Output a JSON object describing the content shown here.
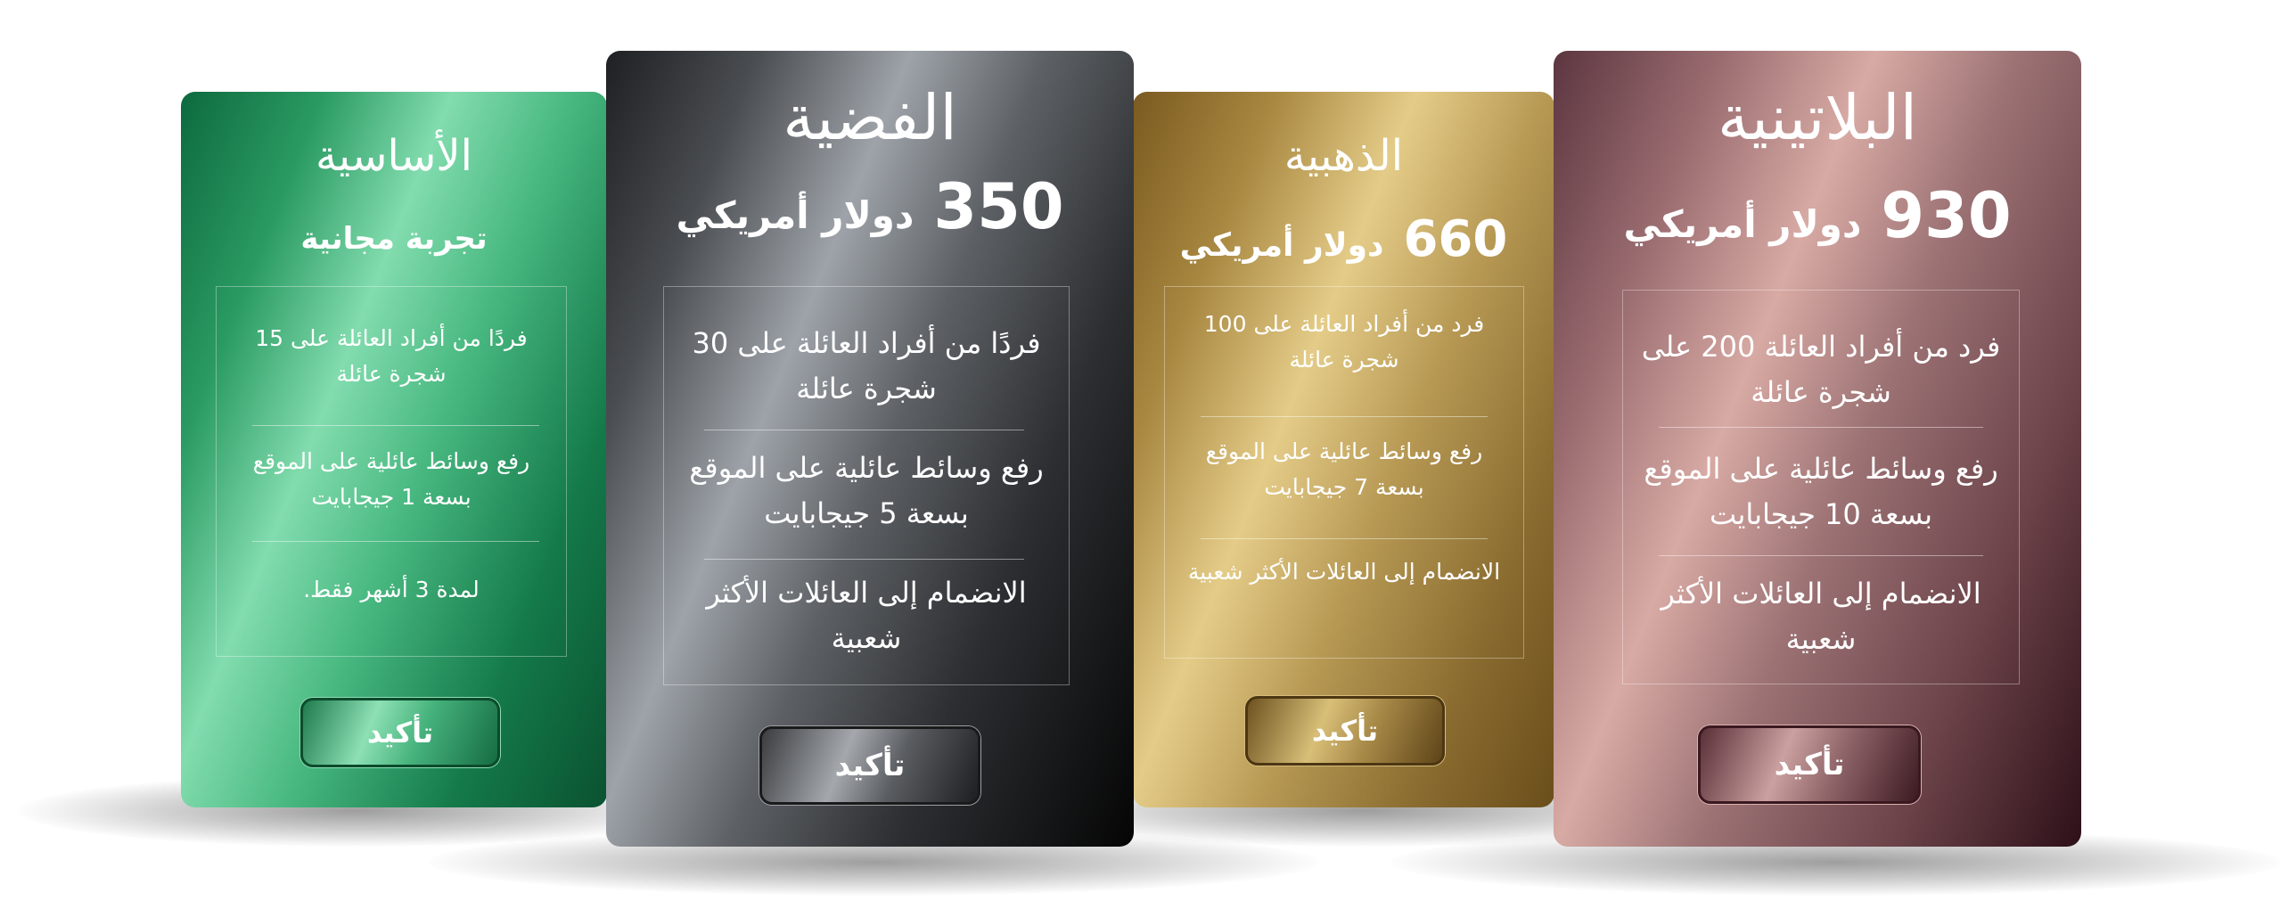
{
  "plans": {
    "basic": {
      "title": "الأساسية",
      "subtitle": "تجربة مجانية",
      "features": [
        "فردًا من أفراد العائلة على 15 شجرة عائلة",
        "رفع وسائط عائلية على الموقع بسعة 1 جيجابايت",
        "لمدة 3 أشهر فقط."
      ],
      "button_label": "تأكيد"
    },
    "silver": {
      "title": "الفضية",
      "price_number": "350",
      "currency": "دولار أمريكي",
      "features": [
        "فردًا من أفراد العائلة على 30 شجرة عائلة",
        "رفع وسائط عائلية على الموقع بسعة 5 جيجابايت",
        "الانضمام إلى العائلات الأكثر شعبية"
      ],
      "button_label": "تأكيد"
    },
    "gold": {
      "title": "الذهبية",
      "price_number": "660",
      "currency": "دولار أمريكي",
      "features": [
        "فرد من أفراد العائلة على 100 شجرة عائلة",
        "رفع وسائط عائلية على الموقع بسعة 7 جيجابايت",
        "الانضمام إلى العائلات الأكثر شعبية"
      ],
      "button_label": "تأكيد"
    },
    "platinum": {
      "title": "البلاتينية",
      "price_number": "930",
      "currency": "دولار أمريكي",
      "features": [
        "فرد من أفراد العائلة 200 على شجرة عائلة",
        "رفع وسائط عائلية على الموقع بسعة 10 جيجابايت",
        "الانضمام إلى العائلات الأكثر شعبية"
      ],
      "button_label": "تأكيد"
    }
  },
  "colors": {
    "basic_accent": "#2a9a62",
    "silver_accent": "#5d6165",
    "gold_accent": "#b89a55",
    "platinum_accent": "#9c7274",
    "text": "#ffffff"
  }
}
